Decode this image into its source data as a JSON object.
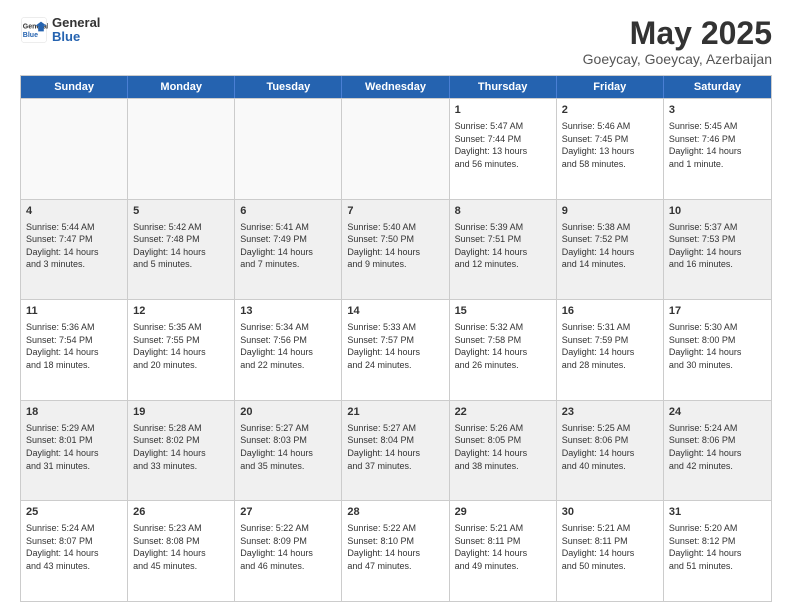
{
  "logo": {
    "line1": "General",
    "line2": "Blue"
  },
  "title": "May 2025",
  "subtitle": "Goeycay, Goeycay, Azerbaijan",
  "header_days": [
    "Sunday",
    "Monday",
    "Tuesday",
    "Wednesday",
    "Thursday",
    "Friday",
    "Saturday"
  ],
  "rows": [
    [
      {
        "day": "",
        "info": "",
        "empty": true
      },
      {
        "day": "",
        "info": "",
        "empty": true
      },
      {
        "day": "",
        "info": "",
        "empty": true
      },
      {
        "day": "",
        "info": "",
        "empty": true
      },
      {
        "day": "1",
        "info": "Sunrise: 5:47 AM\nSunset: 7:44 PM\nDaylight: 13 hours\nand 56 minutes."
      },
      {
        "day": "2",
        "info": "Sunrise: 5:46 AM\nSunset: 7:45 PM\nDaylight: 13 hours\nand 58 minutes."
      },
      {
        "day": "3",
        "info": "Sunrise: 5:45 AM\nSunset: 7:46 PM\nDaylight: 14 hours\nand 1 minute."
      }
    ],
    [
      {
        "day": "4",
        "info": "Sunrise: 5:44 AM\nSunset: 7:47 PM\nDaylight: 14 hours\nand 3 minutes."
      },
      {
        "day": "5",
        "info": "Sunrise: 5:42 AM\nSunset: 7:48 PM\nDaylight: 14 hours\nand 5 minutes."
      },
      {
        "day": "6",
        "info": "Sunrise: 5:41 AM\nSunset: 7:49 PM\nDaylight: 14 hours\nand 7 minutes."
      },
      {
        "day": "7",
        "info": "Sunrise: 5:40 AM\nSunset: 7:50 PM\nDaylight: 14 hours\nand 9 minutes."
      },
      {
        "day": "8",
        "info": "Sunrise: 5:39 AM\nSunset: 7:51 PM\nDaylight: 14 hours\nand 12 minutes."
      },
      {
        "day": "9",
        "info": "Sunrise: 5:38 AM\nSunset: 7:52 PM\nDaylight: 14 hours\nand 14 minutes."
      },
      {
        "day": "10",
        "info": "Sunrise: 5:37 AM\nSunset: 7:53 PM\nDaylight: 14 hours\nand 16 minutes."
      }
    ],
    [
      {
        "day": "11",
        "info": "Sunrise: 5:36 AM\nSunset: 7:54 PM\nDaylight: 14 hours\nand 18 minutes."
      },
      {
        "day": "12",
        "info": "Sunrise: 5:35 AM\nSunset: 7:55 PM\nDaylight: 14 hours\nand 20 minutes."
      },
      {
        "day": "13",
        "info": "Sunrise: 5:34 AM\nSunset: 7:56 PM\nDaylight: 14 hours\nand 22 minutes."
      },
      {
        "day": "14",
        "info": "Sunrise: 5:33 AM\nSunset: 7:57 PM\nDaylight: 14 hours\nand 24 minutes."
      },
      {
        "day": "15",
        "info": "Sunrise: 5:32 AM\nSunset: 7:58 PM\nDaylight: 14 hours\nand 26 minutes."
      },
      {
        "day": "16",
        "info": "Sunrise: 5:31 AM\nSunset: 7:59 PM\nDaylight: 14 hours\nand 28 minutes."
      },
      {
        "day": "17",
        "info": "Sunrise: 5:30 AM\nSunset: 8:00 PM\nDaylight: 14 hours\nand 30 minutes."
      }
    ],
    [
      {
        "day": "18",
        "info": "Sunrise: 5:29 AM\nSunset: 8:01 PM\nDaylight: 14 hours\nand 31 minutes."
      },
      {
        "day": "19",
        "info": "Sunrise: 5:28 AM\nSunset: 8:02 PM\nDaylight: 14 hours\nand 33 minutes."
      },
      {
        "day": "20",
        "info": "Sunrise: 5:27 AM\nSunset: 8:03 PM\nDaylight: 14 hours\nand 35 minutes."
      },
      {
        "day": "21",
        "info": "Sunrise: 5:27 AM\nSunset: 8:04 PM\nDaylight: 14 hours\nand 37 minutes."
      },
      {
        "day": "22",
        "info": "Sunrise: 5:26 AM\nSunset: 8:05 PM\nDaylight: 14 hours\nand 38 minutes."
      },
      {
        "day": "23",
        "info": "Sunrise: 5:25 AM\nSunset: 8:06 PM\nDaylight: 14 hours\nand 40 minutes."
      },
      {
        "day": "24",
        "info": "Sunrise: 5:24 AM\nSunset: 8:06 PM\nDaylight: 14 hours\nand 42 minutes."
      }
    ],
    [
      {
        "day": "25",
        "info": "Sunrise: 5:24 AM\nSunset: 8:07 PM\nDaylight: 14 hours\nand 43 minutes."
      },
      {
        "day": "26",
        "info": "Sunrise: 5:23 AM\nSunset: 8:08 PM\nDaylight: 14 hours\nand 45 minutes."
      },
      {
        "day": "27",
        "info": "Sunrise: 5:22 AM\nSunset: 8:09 PM\nDaylight: 14 hours\nand 46 minutes."
      },
      {
        "day": "28",
        "info": "Sunrise: 5:22 AM\nSunset: 8:10 PM\nDaylight: 14 hours\nand 47 minutes."
      },
      {
        "day": "29",
        "info": "Sunrise: 5:21 AM\nSunset: 8:11 PM\nDaylight: 14 hours\nand 49 minutes."
      },
      {
        "day": "30",
        "info": "Sunrise: 5:21 AM\nSunset: 8:11 PM\nDaylight: 14 hours\nand 50 minutes."
      },
      {
        "day": "31",
        "info": "Sunrise: 5:20 AM\nSunset: 8:12 PM\nDaylight: 14 hours\nand 51 minutes."
      }
    ]
  ]
}
